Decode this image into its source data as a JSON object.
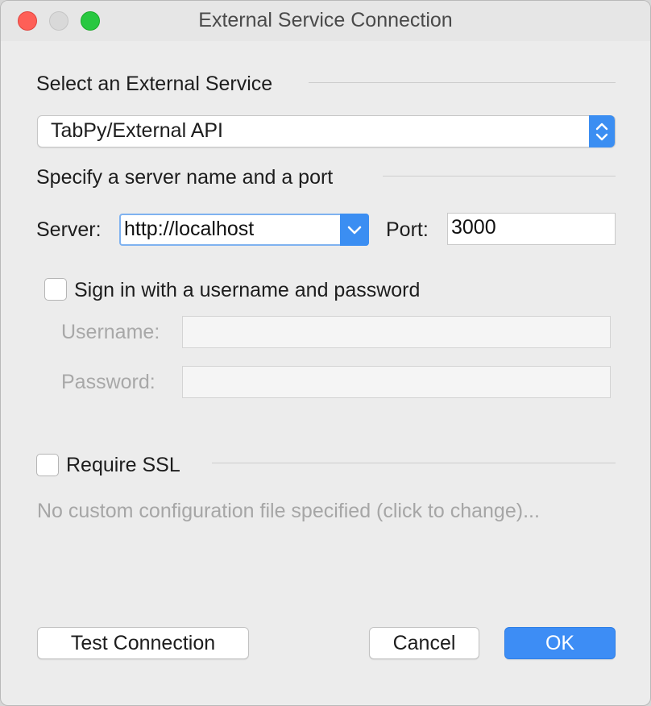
{
  "window": {
    "title": "External Service Connection"
  },
  "service_section": {
    "heading": "Select an External Service",
    "selected_service": "TabPy/External API"
  },
  "server_section": {
    "heading": "Specify a server name and a port",
    "server_label": "Server:",
    "server_value": "http://localhost",
    "port_label": "Port:",
    "port_value": "3000"
  },
  "auth_section": {
    "checkbox_label": "Sign in with a username and password",
    "checked": false,
    "username_label": "Username:",
    "username_value": "",
    "password_label": "Password:",
    "password_value": ""
  },
  "ssl_section": {
    "checkbox_label": "Require SSL",
    "checked": false,
    "config_file_text": "No custom configuration file specified (click to change)..."
  },
  "buttons": {
    "test_connection": "Test Connection",
    "cancel": "Cancel",
    "ok": "OK"
  },
  "colors": {
    "accent": "#3d8df5",
    "close": "#fe5f57",
    "zoom": "#28c840",
    "disabled_text": "#a6a6a6"
  }
}
